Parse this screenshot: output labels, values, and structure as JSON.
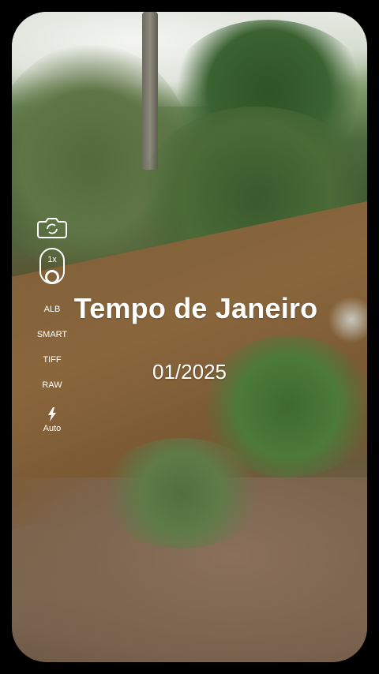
{
  "overlay": {
    "title": "Tempo de Janeiro",
    "date": "01/2025"
  },
  "sidebar": {
    "camera_icon": "camera-switch-icon",
    "zoom_label": "1x",
    "format_items": [
      "ALB",
      "SMART",
      "TIFF",
      "RAW"
    ],
    "flash_icon": "flash-icon",
    "flash_label": "Auto"
  }
}
